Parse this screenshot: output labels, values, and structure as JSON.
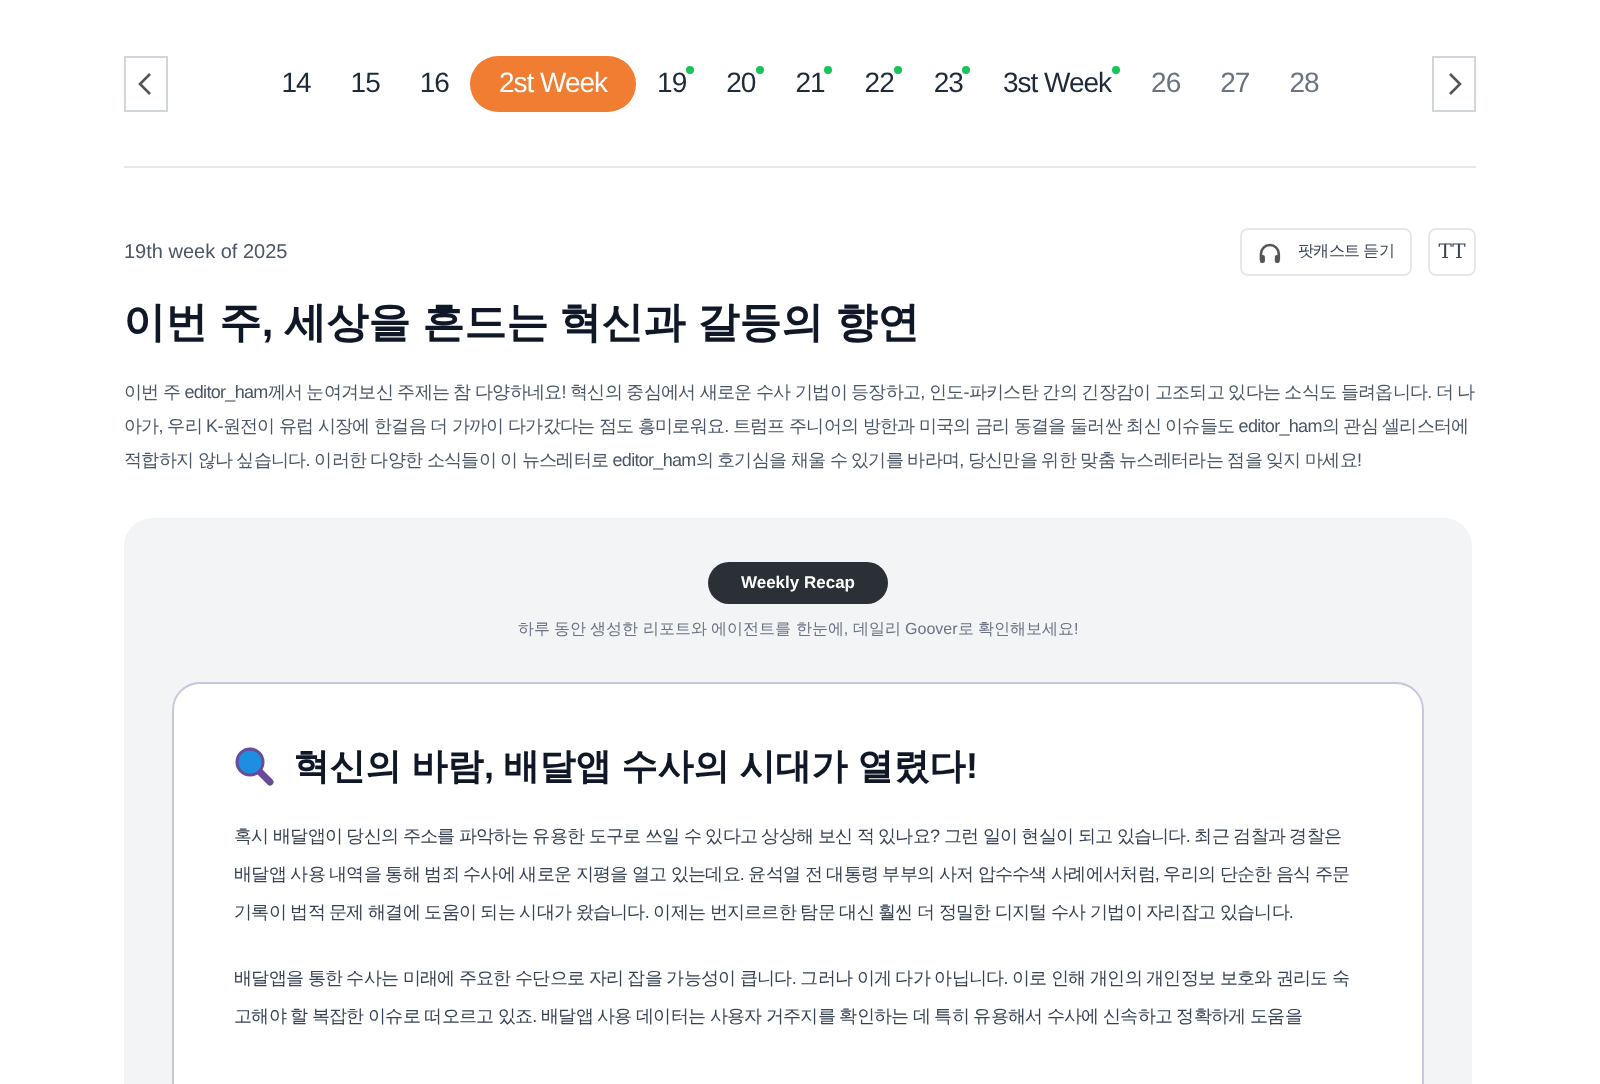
{
  "week_nav": {
    "days": [
      {
        "label": "14",
        "selected": false,
        "has_update": false,
        "disabled": false
      },
      {
        "label": "15",
        "selected": false,
        "has_update": false,
        "disabled": false
      },
      {
        "label": "16",
        "selected": false,
        "has_update": false,
        "disabled": false
      },
      {
        "label": "2st Week",
        "selected": true,
        "has_update": false,
        "disabled": false
      },
      {
        "label": "19",
        "selected": false,
        "has_update": true,
        "disabled": false
      },
      {
        "label": "20",
        "selected": false,
        "has_update": true,
        "disabled": false
      },
      {
        "label": "21",
        "selected": false,
        "has_update": true,
        "disabled": false
      },
      {
        "label": "22",
        "selected": false,
        "has_update": true,
        "disabled": false
      },
      {
        "label": "23",
        "selected": false,
        "has_update": true,
        "disabled": false
      },
      {
        "label": "3st Week",
        "selected": false,
        "has_update": true,
        "disabled": false
      },
      {
        "label": "26",
        "selected": false,
        "has_update": false,
        "disabled": true
      },
      {
        "label": "27",
        "selected": false,
        "has_update": false,
        "disabled": true
      },
      {
        "label": "28",
        "selected": false,
        "has_update": false,
        "disabled": true
      }
    ]
  },
  "header": {
    "week_label": "19th week of 2025",
    "podcast_button": "팟캐스트 듣기",
    "font_button": "TT",
    "title": "이번 주, 세상을 흔드는 혁신과 갈등의 향연",
    "intro": "이번 주 editor_ham께서 눈여겨보신 주제는 참 다양하네요! 혁신의 중심에서 새로운 수사 기법이 등장하고, 인도-파키스탄 간의 긴장감이 고조되고 있다는 소식도 들려옵니다. 더 나아가, 우리 K-원전이 유럽 시장에 한걸음 더 가까이 다가갔다는 점도 흥미로워요. 트럼프 주니어의 방한과 미국의 금리 동결을 둘러싼 최신 이슈들도 editor_ham의 관심 셀리스터에 적합하지 않나 싶습니다. 이러한 다양한 소식들이 이 뉴스레터로 editor_ham의 호기심을 채울 수 있기를 바라며, 당신만을 위한 맞춤 뉴스레터라는 점을 잊지 마세요!"
  },
  "recap": {
    "badge": "Weekly Recap",
    "subtitle": "하루 동안 생성한 리포트와 에이전트를 한눈에, 데일리 Goover로 확인해보세요!",
    "article": {
      "title": "혁신의 바람, 배달앱 수사의 시대가 열렸다!",
      "paragraphs": [
        "혹시 배달앱이 당신의 주소를 파악하는 유용한 도구로 쓰일 수 있다고 상상해 보신 적 있나요? 그런 일이 현실이 되고 있습니다. 최근 검찰과 경찰은 배달앱 사용 내역을 통해 범죄 수사에 새로운 지평을 열고 있는데요. 윤석열 전 대통령 부부의 사저 압수수색 사례에서처럼, 우리의 단순한 음식 주문 기록이 법적 문제 해결에 도움이 되는 시대가 왔습니다. 이제는 번지르르한 탐문 대신 훨씬 더 정밀한 디지털 수사 기법이 자리잡고 있습니다.",
        "배달앱을 통한 수사는 미래에 주요한 수단으로 자리 잡을 가능성이 큽니다. 그러나 이게 다가 아닙니다. 이로 인해 개인의 개인정보 보호와 권리도 숙고해야 할 복잡한 이슈로 떠오르고 있죠. 배달앱 사용 데이터는 사용자 거주지를 확인하는 데 특히 유용해서 수사에 신속하고 정확하게 도움을"
      ]
    }
  }
}
